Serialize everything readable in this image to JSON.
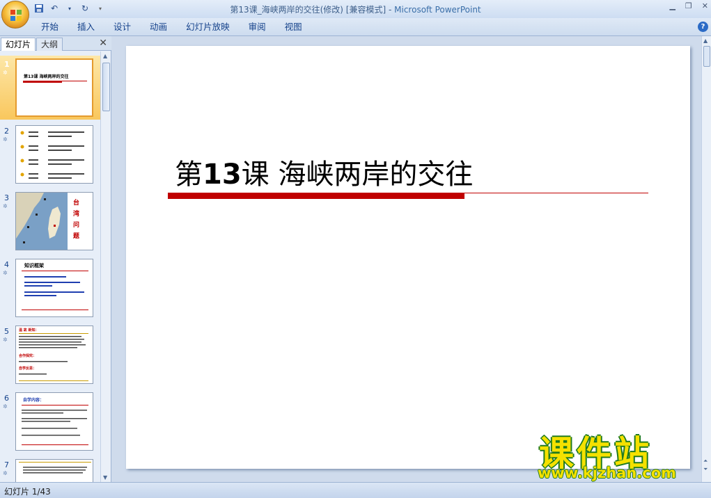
{
  "window": {
    "title": "第13课_海峡两岸的交往(修改) [兼容模式]",
    "app_name": "Microsoft PowerPoint"
  },
  "ribbon": {
    "tabs": [
      "开始",
      "插入",
      "设计",
      "动画",
      "幻灯片放映",
      "审阅",
      "视图"
    ]
  },
  "pane": {
    "tab_slides": "幻灯片",
    "tab_outline": "大纲",
    "thumbnails": [
      {
        "num": "1",
        "title": "第13课 海峡两岸的交往"
      },
      {
        "num": "2"
      },
      {
        "num": "3",
        "labels": [
          "台",
          "湾",
          "问",
          "题"
        ]
      },
      {
        "num": "4",
        "title": "知识框架"
      },
      {
        "num": "5",
        "title": "温 故 新知：",
        "sub": "合作探究：",
        "sub2": "自学反思："
      },
      {
        "num": "6",
        "title": "自学内容："
      },
      {
        "num": "7"
      }
    ]
  },
  "slide": {
    "title_pre": "第",
    "title_num": "13",
    "title_post": "课 海峡两岸的交往"
  },
  "status": {
    "slide_indicator": "幻灯片 1/43"
  },
  "watermark": {
    "line1": "课件站",
    "line2": "www.kjzhan.com"
  },
  "colors": {
    "accent_red": "#c00000",
    "selection": "#f9c75d",
    "watermark_fill": "#f5e100",
    "watermark_outline": "#1f7a1f"
  }
}
